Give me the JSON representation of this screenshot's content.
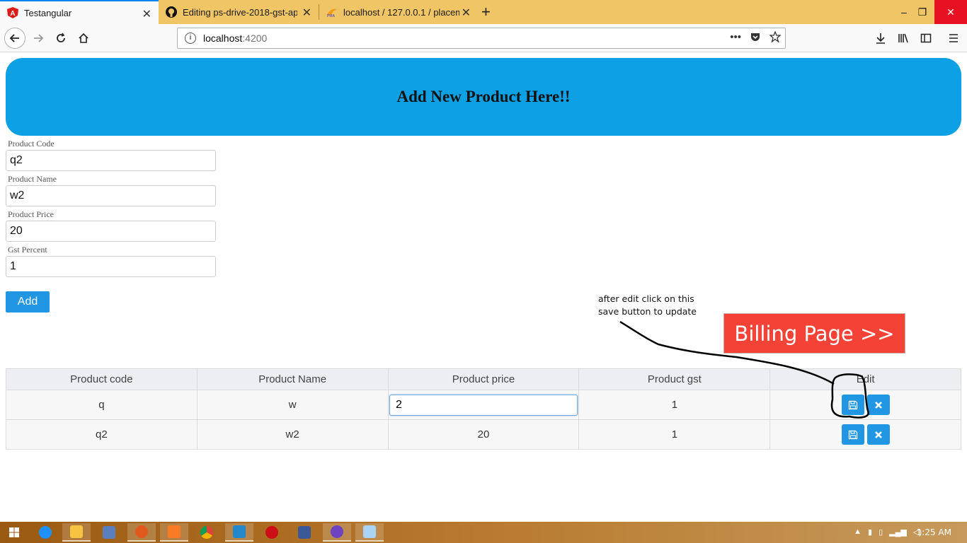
{
  "browser": {
    "tabs": [
      {
        "label": "Testangular",
        "icon": "angular-icon",
        "active": true
      },
      {
        "label": "Editing ps-drive-2018-gst-app/",
        "icon": "github-icon",
        "active": false
      },
      {
        "label": "localhost / 127.0.0.1 / placemen",
        "icon": "phpmyadmin-icon",
        "active": false
      }
    ],
    "new_tab_glyph": "+",
    "url_host": "localhost",
    "url_port": ":4200",
    "window_controls": {
      "minimize": "–",
      "maximize": "❐",
      "close": "✕"
    }
  },
  "page": {
    "banner_title": "Add New Product Here!!",
    "form": {
      "code_label": "Product Code",
      "code_value": "q2",
      "name_label": "Product Name",
      "name_value": "w2",
      "price_label": "Product Price",
      "price_value": "20",
      "gst_label": "Gst Percent",
      "gst_value": "1",
      "add_label": "Add"
    },
    "annotation_line1": "after edit click on this",
    "annotation_line2": "save button to update",
    "billing_label": "Billing Page >>",
    "table": {
      "headers": [
        "Product code",
        "Product Name",
        "Product price",
        "Product gst",
        "Edit"
      ],
      "rows": [
        {
          "code": "q",
          "name": "w",
          "price": "2",
          "gst": "1",
          "price_editing": true
        },
        {
          "code": "q2",
          "name": "w2",
          "price": "20",
          "gst": "1",
          "price_editing": false
        }
      ]
    }
  },
  "taskbar": {
    "clock": "1:25 AM"
  },
  "colors": {
    "banner": "#0da0e4",
    "primary_button": "#2196e3",
    "billing_button": "#f44336",
    "tabbar": "#f0c566"
  }
}
